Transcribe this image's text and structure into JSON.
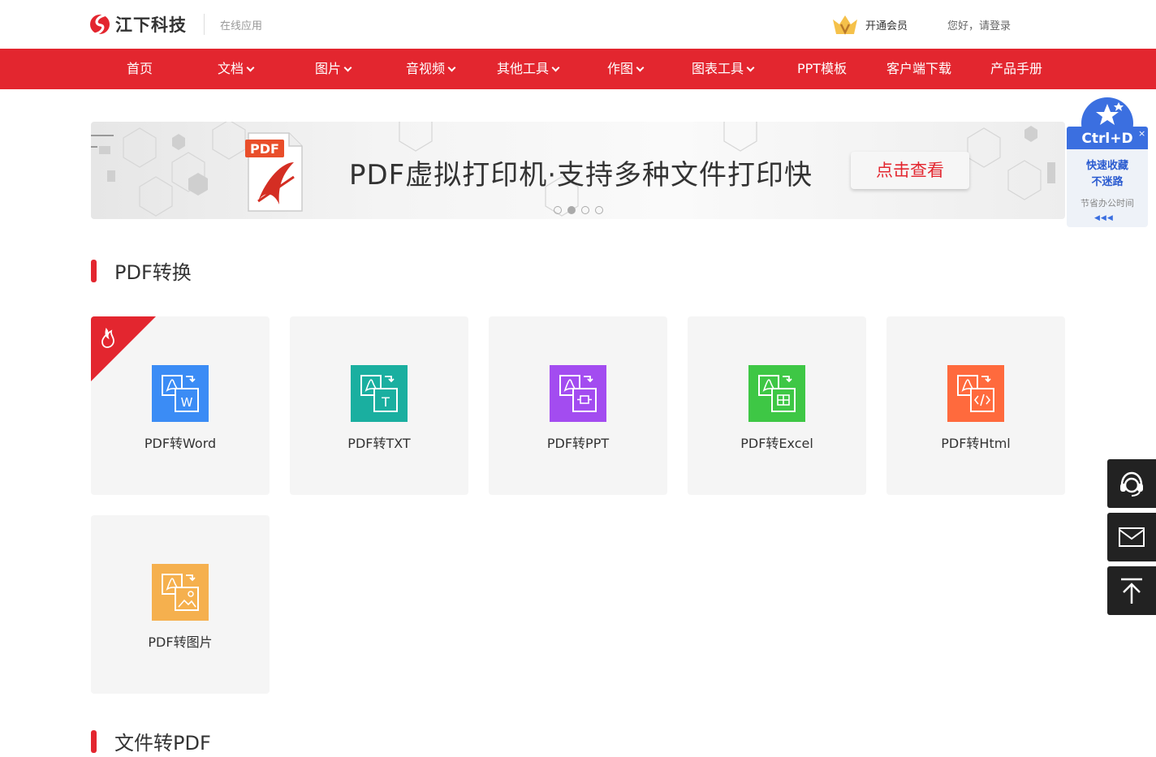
{
  "header": {
    "brand": "江下科技",
    "subtitle": "在线应用",
    "vip_label": "开通会员",
    "login_label": "您好，请登录"
  },
  "nav": {
    "items": [
      {
        "label": "首页",
        "dropdown": false
      },
      {
        "label": "文档",
        "dropdown": true
      },
      {
        "label": "图片",
        "dropdown": true
      },
      {
        "label": "音视频",
        "dropdown": true
      },
      {
        "label": "其他工具",
        "dropdown": true
      },
      {
        "label": "作图",
        "dropdown": true
      },
      {
        "label": "图表工具",
        "dropdown": true
      },
      {
        "label": "PPT模板",
        "dropdown": false
      },
      {
        "label": "客户端下载",
        "dropdown": false
      },
      {
        "label": "产品手册",
        "dropdown": false
      }
    ]
  },
  "banner": {
    "badge": "PDF",
    "title": "PDF虚拟打印机·支持多种文件打印快",
    "button": "点击查看",
    "slides": 4,
    "active_slide": 2
  },
  "bookmark_widget": {
    "shortcut": "Ctrl+D",
    "line1": "快速收藏",
    "line2": "不迷路",
    "line3": "节省办公时间",
    "close": "×",
    "arrows": "◀◀◀"
  },
  "sections": [
    {
      "title": "PDF转换",
      "tools": [
        {
          "label": "PDF转Word",
          "color": "#3b8cf5",
          "icon": "pdf-to-word-icon",
          "hot": true
        },
        {
          "label": "PDF转TXT",
          "color": "#1aafa0",
          "icon": "pdf-to-txt-icon",
          "hot": false
        },
        {
          "label": "PDF转PPT",
          "color": "#a34cf0",
          "icon": "pdf-to-ppt-icon",
          "hot": false
        },
        {
          "label": "PDF转Excel",
          "color": "#3ec745",
          "icon": "pdf-to-excel-icon",
          "hot": false
        },
        {
          "label": "PDF转Html",
          "color": "#ff6a3d",
          "icon": "pdf-to-html-icon",
          "hot": false
        },
        {
          "label": "PDF转图片",
          "color": "#f5b04e",
          "icon": "pdf-to-image-icon",
          "hot": false
        }
      ]
    },
    {
      "title": "文件转PDF",
      "tools": []
    }
  ],
  "colors": {
    "brand_red": "#e3262f",
    "widget_blue": "#3b6fe0",
    "side_buttons": "#222222"
  },
  "side_buttons": [
    "customer-service-icon",
    "mail-icon",
    "back-to-top-icon"
  ]
}
